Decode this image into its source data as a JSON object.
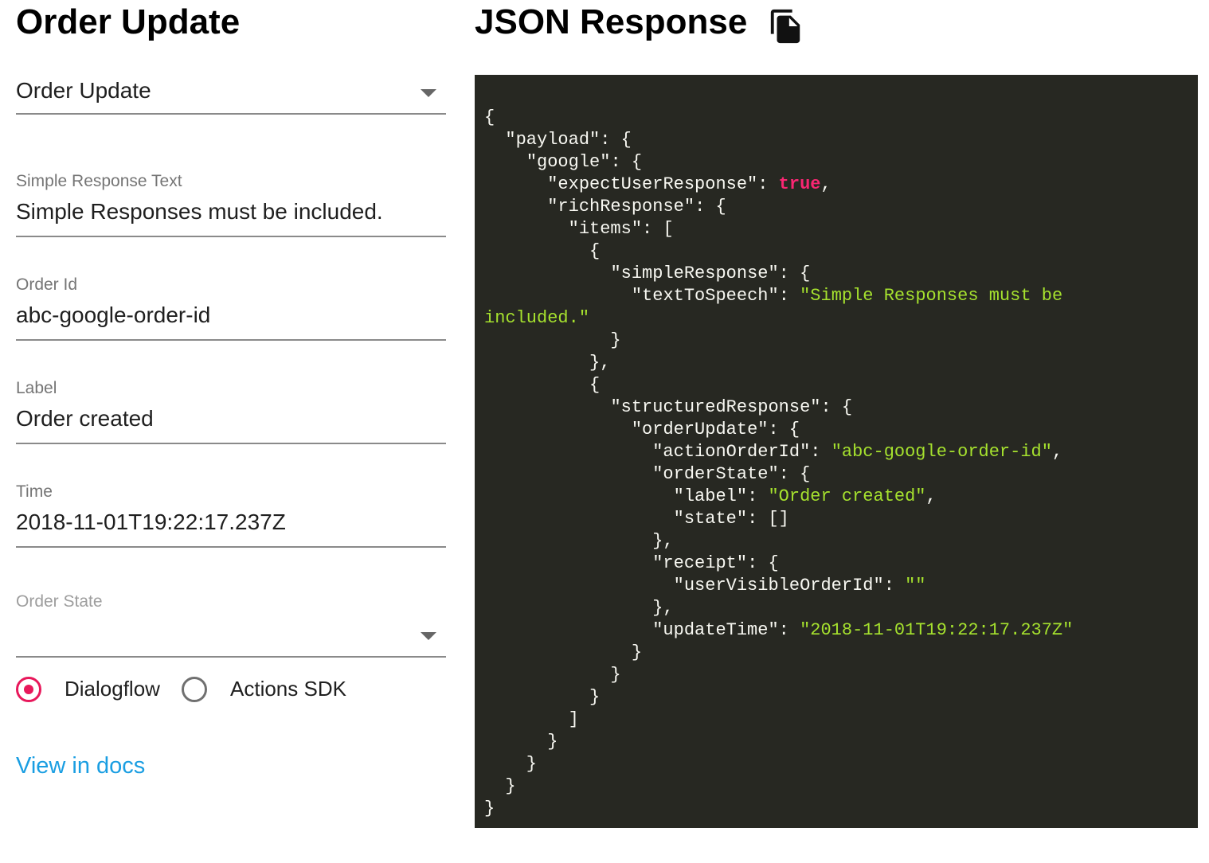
{
  "left_panel": {
    "title": "Order Update",
    "type_select": {
      "value": "Order Update"
    },
    "fields": {
      "simple_response": {
        "label": "Simple Response Text",
        "value": "Simple Responses must be included."
      },
      "order_id": {
        "label": "Order Id",
        "value": "abc-google-order-id"
      },
      "label": {
        "label": "Label",
        "value": "Order created"
      },
      "time": {
        "label": "Time",
        "value": "2018-11-01T19:22:17.237Z"
      }
    },
    "order_state": {
      "label": "Order State",
      "value": ""
    },
    "radio_group": {
      "options": [
        "Dialogflow",
        "Actions SDK"
      ],
      "selected": "Dialogflow"
    },
    "docs_link": "View in docs"
  },
  "right_panel": {
    "title": "JSON Response",
    "copy_icon": "content-copy-icon",
    "code": {
      "k_payload": "\"payload\"",
      "k_google": "\"google\"",
      "k_expect": "\"expectUserResponse\"",
      "v_expect": "true",
      "k_rich": "\"richResponse\"",
      "k_items": "\"items\"",
      "k_simple": "\"simpleResponse\"",
      "k_tts": "\"textToSpeech\"",
      "v_tts_1": "\"Simple Responses must be",
      "v_tts_2": "included.\"",
      "k_structured": "\"structuredResponse\"",
      "k_order_update": "\"orderUpdate\"",
      "k_action_id": "\"actionOrderId\"",
      "v_action_id": "\"abc-google-order-id\"",
      "k_order_state": "\"orderState\"",
      "k_label": "\"label\"",
      "v_label": "\"Order created\"",
      "k_state": "\"state\"",
      "k_receipt": "\"receipt\"",
      "k_user_visible": "\"userVisibleOrderId\"",
      "v_user_visible": "\"\"",
      "k_update_time": "\"updateTime\"",
      "v_update_time": "\"2018-11-01T19:22:17.237Z\""
    }
  },
  "colors": {
    "accent": "#e8185b",
    "link": "#1a9ee2",
    "code_background": "#272822",
    "code_string": "#a6e22e",
    "code_keyword": "#f92672"
  }
}
